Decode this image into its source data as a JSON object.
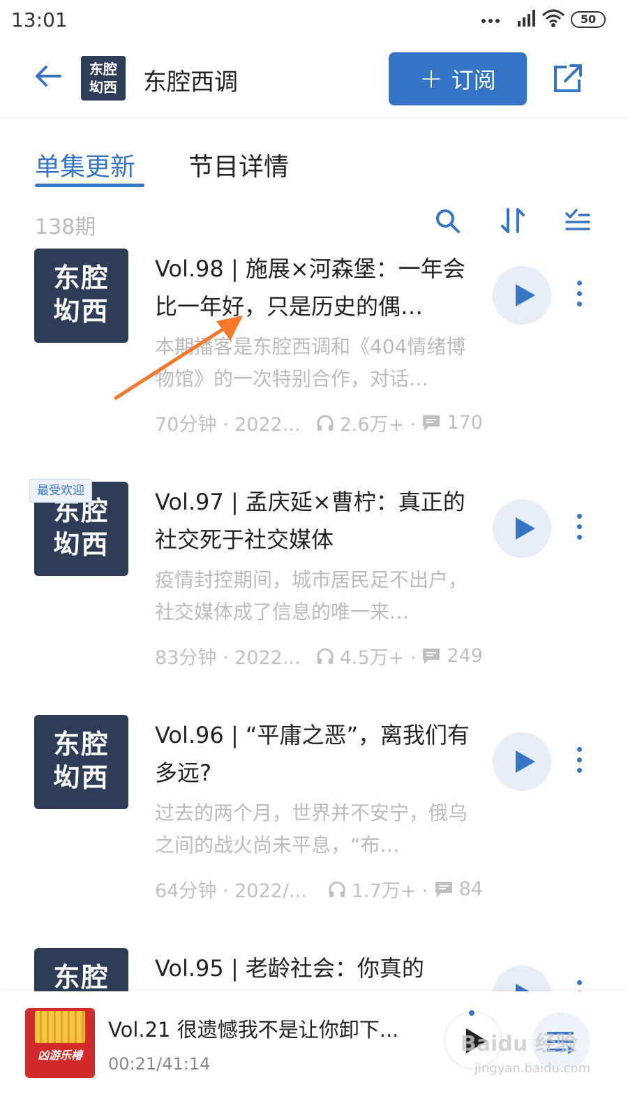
{
  "status_bar": {
    "time": "13:01",
    "battery": "50"
  },
  "header": {
    "podcast_title": "东腔西调",
    "logo_line1": "东腔",
    "logo_line2": "㘭西",
    "subscribe_label": "订阅"
  },
  "tabs": [
    {
      "label": "单集更新",
      "active": true
    },
    {
      "label": "节目详情",
      "active": false
    }
  ],
  "episode_count": "138期",
  "episodes": [
    {
      "title": "Vol.98 | 施展×河森堡：一年会比一年好，只是历史的偶…",
      "desc": "本期播客是东腔西调和《404情绪博物馆》的一次特别合作，对话…",
      "duration_date": "70分钟 · 2022...",
      "plays": "2.6万+ ·",
      "comments": "170",
      "cover_line1": "东腔",
      "cover_line2": "㘭西"
    },
    {
      "badge": "最受欢迎",
      "title": "Vol.97 | 孟庆延×曹柠：真正的社交死于社交媒体",
      "desc": "疫情封控期间，城市居民足不出户，社交媒体成了信息的唯一来…",
      "duration_date": "83分钟 · 2022...",
      "plays": "4.5万+ ·",
      "comments": "249",
      "cover_line1": "东腔",
      "cover_line2": "㘭西"
    },
    {
      "title": "Vol.96 | “平庸之恶”，离我们有多远?",
      "desc": "过去的两个月，世界并不安宁，俄乌之间的战火尚未平息，“布…",
      "duration_date": "64分钟 · 2022/...",
      "plays": "1.7万+ ·",
      "comments": "84",
      "cover_line1": "东腔",
      "cover_line2": "㘭西"
    },
    {
      "title": "Vol.95 | 老龄社会：你真的",
      "cover_line1": "东腔",
      "cover_line2": "㘭西"
    }
  ],
  "player": {
    "title": "Vol.21 很遗憾我不是让你卸下...",
    "time": "00:21/41:14",
    "cover_text": "凶游乐椿",
    "progress": 0.01
  },
  "watermark": {
    "line1": "Baidu 经验",
    "line2": "jingyan.baidu.com"
  },
  "colors": {
    "accent": "#3575c6",
    "cover_bg": "#2e3d57",
    "annotation_arrow": "#f5782a"
  }
}
